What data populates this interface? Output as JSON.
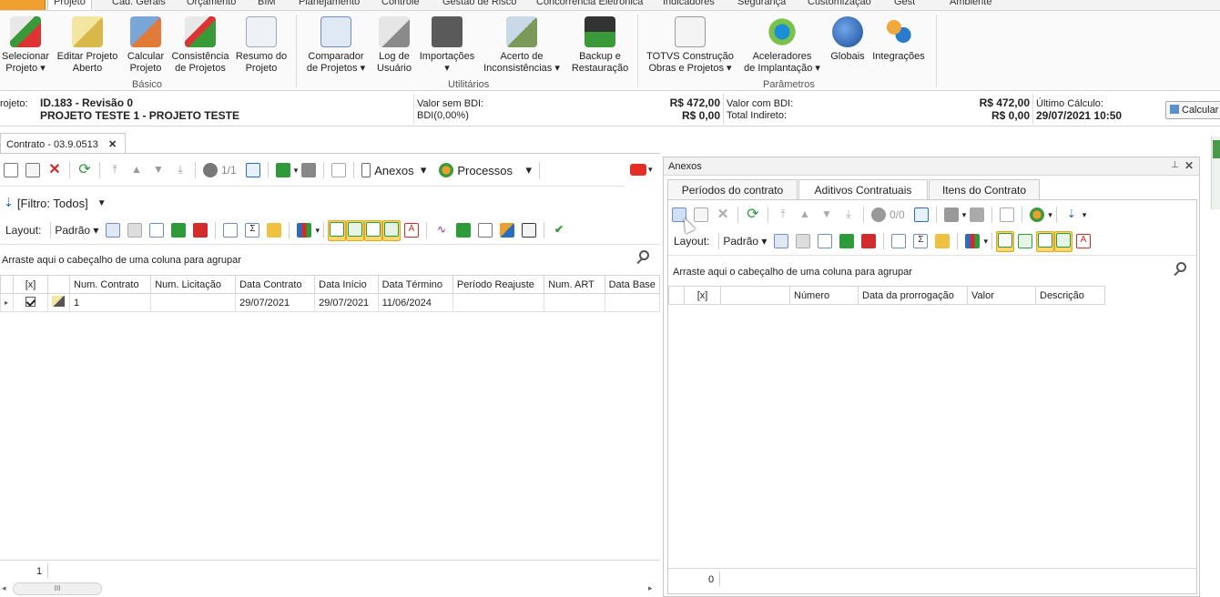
{
  "ribbon_tabs": [
    "Projeto",
    "Cad. Gerais",
    "Orçamento",
    "BIM",
    "Planejamento",
    "Controle",
    "Gestão de Risco",
    "Concorrência Eletrônica",
    "Indicadores",
    "Segurança",
    "Customização",
    "Gest",
    "Ambiente"
  ],
  "ribbon": {
    "buttons": [
      {
        "label1": "Selecionar",
        "label2": "Projeto",
        "dropdown": true
      },
      {
        "label1": "Editar Projeto",
        "label2": "Aberto"
      },
      {
        "label1": "Calcular",
        "label2": "Projeto"
      },
      {
        "label1": "Consistência",
        "label2": "de Projetos"
      },
      {
        "label1": "Resumo do",
        "label2": "Projeto"
      },
      {
        "label1": "Comparador",
        "label2": "de Projetos",
        "dropdown": true
      },
      {
        "label1": "Log de",
        "label2": "Usuário"
      },
      {
        "label1": "Importações",
        "label2": "",
        "dropdown": true
      },
      {
        "label1": "Acerto de",
        "label2": "Inconsistências",
        "dropdown": true
      },
      {
        "label1": "Backup e",
        "label2": "Restauração"
      },
      {
        "label1": "TOTVS Construção",
        "label2": "Obras e Projetos",
        "dropdown": true
      },
      {
        "label1": "Aceleradores",
        "label2": "de Implantação",
        "dropdown": true
      },
      {
        "label1": "Globais",
        "label2": ""
      },
      {
        "label1": "Integrações",
        "label2": ""
      }
    ],
    "groups": [
      "Básico",
      "Utilitários",
      "Parâmetros"
    ]
  },
  "info": {
    "projeto_label": "rojeto:",
    "projeto_id": "ID.183 - Revisão 0",
    "projeto_nome": "PROJETO TESTE 1 - PROJETO TESTE",
    "valor_sem_bdi_label": "Valor sem BDI:",
    "valor_sem_bdi": "R$ 472,00",
    "bdi_label": "BDI(0,00%)",
    "bdi_valor": "R$ 0,00",
    "valor_com_bdi_label": "Valor com BDI:",
    "valor_com_bdi": "R$ 472,00",
    "total_indireto_label": "Total Indireto:",
    "total_indireto": "R$ 0,00",
    "ultimo_calculo_label": "Último Cálculo:",
    "ultimo_calculo": "29/07/2021 10:50",
    "calcular_label": "Calcular"
  },
  "doc_tab": {
    "label": "Contrato - 03.9.0513"
  },
  "left": {
    "pager": "1/1",
    "anexos_label": "Anexos",
    "processos_label": "Processos",
    "filter_label": "[Filtro: Todos]",
    "layout_label": "Layout:",
    "padrao_label": "Padrão",
    "group_hint": "Arraste aqui o cabeçalho de uma coluna para agrupar",
    "columns": [
      "[x]",
      "",
      "Num. Contrato",
      "Num. Licitação",
      "Data Contrato",
      "Data Início",
      "Data Término",
      "Período Reajuste",
      "Num. ART",
      "Data Base"
    ],
    "rows": [
      {
        "checked": true,
        "num_contrato": "1",
        "num_licitacao": "",
        "data_contrato": "29/07/2021",
        "data_inicio": "29/07/2021",
        "data_termino": "11/06/2024",
        "periodo_reajuste": "",
        "num_art": "",
        "data_base": ""
      }
    ],
    "footer_count": "1",
    "scroll_grip": "III"
  },
  "right": {
    "title": "Anexos",
    "tabs": [
      "Períodos do contrato",
      "Aditivos Contratuais",
      "Itens do Contrato"
    ],
    "active_tab": 1,
    "pager": "0/0",
    "layout_label": "Layout:",
    "padrao_label": "Padrão",
    "group_hint": "Arraste aqui o cabeçalho de uma coluna para agrupar",
    "columns": [
      "",
      "[x]",
      "",
      "Número",
      "Data da prorrogação",
      "Valor",
      "Descrição"
    ],
    "footer_count": "0"
  },
  "colors": {
    "accent": "#f0a030",
    "highlight": "#fcd86a",
    "green": "#2e9b3a",
    "red": "#d22b2b"
  }
}
